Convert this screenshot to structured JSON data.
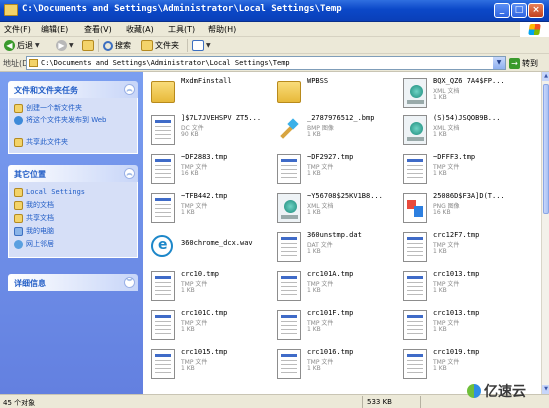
{
  "window": {
    "title": "C:\\Documents and Settings\\Administrator\\Local Settings\\Temp",
    "controls": {
      "minimize": "_",
      "maximize": "□",
      "close": "×"
    }
  },
  "menu": [
    "文件(F)",
    "编辑(E)",
    "查看(V)",
    "收藏(A)",
    "工具(T)",
    "帮助(H)"
  ],
  "toolbar": {
    "back": "后退",
    "search": "搜索",
    "folders": "文件夹"
  },
  "address": {
    "label": "地址(D)",
    "path": "C:\\Documents and Settings\\Administrator\\Local Settings\\Temp",
    "go": "转到"
  },
  "left_panel": {
    "tasks": {
      "title": "文件和文件夹任务",
      "items": [
        "创建一个新文件夹",
        "将这个文件夹发布到 Web",
        "共享此文件夹"
      ]
    },
    "other": {
      "title": "其它位置",
      "items": [
        "Local Settings",
        "我的文档",
        "共享文档",
        "我的电脑",
        "网上邻居"
      ]
    },
    "details": {
      "title": "详细信息"
    }
  },
  "files": [
    {
      "name": "MxdmFinstall",
      "type": "",
      "size": "",
      "icon": "folder-icon"
    },
    {
      "name": "WPBSS",
      "type": "",
      "size": "",
      "icon": "folder-icon"
    },
    {
      "name": "BQX_QZ6 7A4$FP...",
      "type": "XML 文档",
      "size": "1 KB",
      "icon": "xml-icon"
    },
    {
      "name": "]$7L7JVEHSPV ZT5...",
      "type": "DC 文件",
      "size": "90 KB",
      "icon": "document-icon"
    },
    {
      "name": "_2787976512_.bmp",
      "type": "BMP 图像",
      "size": "1 KB",
      "icon": "paint-icon"
    },
    {
      "name": "(S)54)JSQOB9B...",
      "type": "XML 文档",
      "size": "1 KB",
      "icon": "xml-icon"
    },
    {
      "name": "~DF2883.tmp",
      "type": "TMP 文件",
      "size": "16 KB",
      "icon": "document-icon"
    },
    {
      "name": "~DF2927.tmp",
      "type": "TMP 文件",
      "size": "1 KB",
      "icon": "document-icon"
    },
    {
      "name": "~DFFF3.tmp",
      "type": "TMP 文件",
      "size": "1 KB",
      "icon": "document-icon"
    },
    {
      "name": "~TFB442.tmp",
      "type": "TMP 文件",
      "size": "1 KB",
      "icon": "document-icon"
    },
    {
      "name": "~Y56708$25KV1B8...",
      "type": "XML 文档",
      "size": "1 KB",
      "icon": "xml-icon"
    },
    {
      "name": "25086D$F3A]D(T...",
      "type": "PNG 图像",
      "size": "16 KB",
      "icon": "png-icon"
    },
    {
      "name": "360chrome_dcx.wav",
      "type": "",
      "size": "",
      "icon": "audio-icon"
    },
    {
      "name": "360unstmp.dat",
      "type": "DAT 文件",
      "size": "1 KB",
      "icon": "document-icon"
    },
    {
      "name": "crc12F7.tmp",
      "type": "TMP 文件",
      "size": "1 KB",
      "icon": "document-icon"
    },
    {
      "name": "crc10.tmp",
      "type": "TMP 文件",
      "size": "1 KB",
      "icon": "document-icon"
    },
    {
      "name": "crc101A.tmp",
      "type": "TMP 文件",
      "size": "1 KB",
      "icon": "document-icon"
    },
    {
      "name": "crc1013.tmp",
      "type": "TMP 文件",
      "size": "1 KB",
      "icon": "document-icon"
    },
    {
      "name": "crc101C.tmp",
      "type": "TMP 文件",
      "size": "1 KB",
      "icon": "document-icon"
    },
    {
      "name": "crc101F.tmp",
      "type": "TMP 文件",
      "size": "1 KB",
      "icon": "document-icon"
    },
    {
      "name": "crc1013.tmp",
      "type": "TMP 文件",
      "size": "1 KB",
      "icon": "document-icon"
    },
    {
      "name": "crc1015.tmp",
      "type": "TMP 文件",
      "size": "1 KB",
      "icon": "document-icon"
    },
    {
      "name": "crc1016.tmp",
      "type": "TMP 文件",
      "size": "1 KB",
      "icon": "document-icon"
    },
    {
      "name": "crc1019.tmp",
      "type": "TMP 文件",
      "size": "1 KB",
      "icon": "document-icon"
    }
  ],
  "status": {
    "count": "45 个对象",
    "size": "533 KB"
  },
  "watermark": "亿速云"
}
